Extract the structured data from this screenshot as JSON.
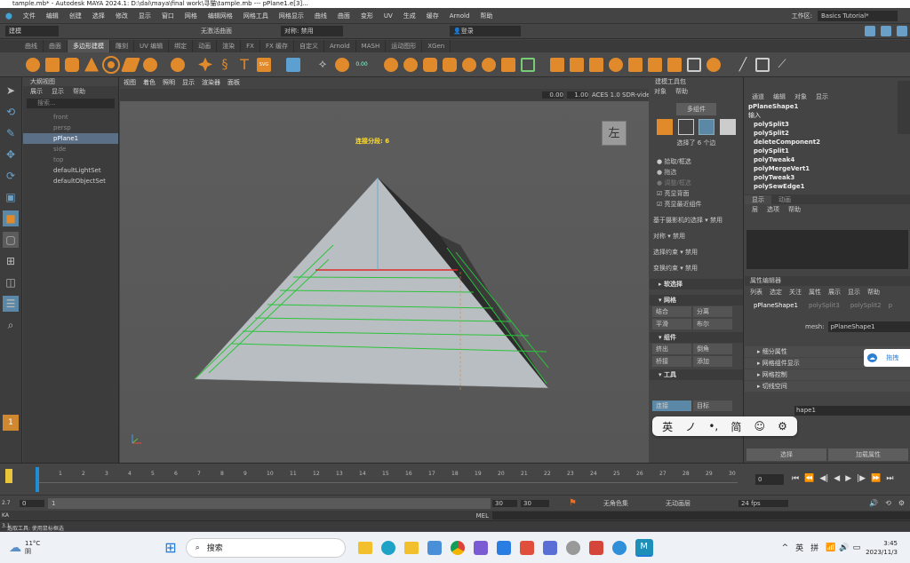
{
  "window": {
    "title": "tample.mb* - Autodesk MAYA 2024.1: D:\\dai\\maya\\final work\\寻猫\\tample.mb  ---  pPlane1.e[3]..."
  },
  "menu": [
    "文件",
    "编辑",
    "创建",
    "选择",
    "修改",
    "显示",
    "窗口",
    "网格",
    "编辑网格",
    "网格工具",
    "网格显示",
    "曲线",
    "曲面",
    "变形",
    "UV",
    "生成",
    "缓存",
    "Arnold",
    "帮助"
  ],
  "workspace": {
    "label": "工作区:",
    "value": "Basics Tutorial*"
  },
  "status_line": {
    "mode": "建模",
    "live_surface": "无激活曲面",
    "symmetry": "对称: 禁用",
    "login": "登录"
  },
  "shelf_tabs": [
    "曲线",
    "曲面",
    "多边形建模",
    "雕刻",
    "UV 编辑",
    "绑定",
    "动画",
    "渲染",
    "FX",
    "FX 缓存",
    "自定义",
    "Arnold",
    "MASH",
    "运动图形",
    "XGen"
  ],
  "shelf_active": "多边形建模",
  "outliner": {
    "title": "大纲视图",
    "menu": [
      "展示",
      "显示",
      "帮助"
    ],
    "search_placeholder": "搜索...",
    "items": [
      "front",
      "persp",
      "pPlane1",
      "side",
      "top",
      "defaultLightSet",
      "defaultObjectSet"
    ],
    "selected": "pPlane1"
  },
  "viewport": {
    "menu": [
      "视图",
      "着色",
      "照明",
      "显示",
      "渲染器",
      "面板"
    ],
    "value1": "0.00",
    "value2": "1.00",
    "colorspace": "ACES 1.0 SDR-vide",
    "hud": "连接分段: 6",
    "viewcube": "左"
  },
  "tool_settings": {
    "title": "建模工具包",
    "menu": [
      "对象",
      "帮助"
    ],
    "mode": "多组件",
    "selected_info": "选择了 6 个边",
    "options": [
      "拾取/框选",
      "拖选",
      "调整/框选"
    ],
    "checkboxes": [
      "亮显背面",
      "亮显最近组件"
    ],
    "camera_sel": {
      "label": "基于摄影机的选择",
      "value": "禁用"
    },
    "symmetry": {
      "label": "对称",
      "value": "禁用"
    },
    "sel_constraint": {
      "label": "选择约束",
      "value": "禁用"
    },
    "xform_constraint": {
      "label": "变换约束",
      "value": "禁用"
    },
    "soft_select": "软选择",
    "mesh_section": "网格",
    "mesh_buttons": [
      "结合",
      "分离",
      "平滑",
      "布尔"
    ],
    "component_section": "组件",
    "component_buttons": [
      "挤出",
      "倒角",
      "桥接",
      "添加"
    ],
    "tools_section": "工具",
    "tool_buttons": [
      "连接",
      "目标"
    ]
  },
  "channel_box": {
    "menu": [
      "通道",
      "编辑",
      "对象",
      "显示"
    ],
    "object": "pPlaneShape1",
    "inputs_label": "输入",
    "inputs": [
      "polySplit3",
      "polySplit2",
      "deleteComponent2",
      "polySplit1",
      "polyTweak4",
      "polyMergeVert1",
      "polyTweak3",
      "polySewEdge1"
    ],
    "layer_tabs": [
      "显示",
      "动画"
    ],
    "layer_menu": [
      "层",
      "选项",
      "帮助"
    ]
  },
  "attr_editor": {
    "title": "属性编辑器",
    "menu": [
      "列表",
      "选定",
      "关注",
      "属性",
      "展示",
      "显示",
      "帮助"
    ],
    "tabs": [
      "pPlaneShape1",
      "polySplit3",
      "polySplit2",
      "p"
    ],
    "mesh_label": "mesh:",
    "mesh_value": "pPlaneShape1",
    "sections": [
      "细分属性",
      "网格组件显示",
      "网格控制",
      "切线空间"
    ],
    "shape_text": "hape1",
    "select_btn": "选择",
    "load_btn": "加载属性",
    "side_btn": "拖拽"
  },
  "timeline": {
    "ticks": [
      "0",
      "1",
      "2",
      "3",
      "4",
      "5",
      "6",
      "7",
      "8",
      "9",
      "10",
      "11",
      "12",
      "13",
      "14",
      "15",
      "16",
      "17",
      "18",
      "19",
      "20",
      "21",
      "22",
      "23",
      "24",
      "25",
      "26",
      "27",
      "28",
      "29",
      "30"
    ],
    "current": "0"
  },
  "range": {
    "start": "0",
    "inner": "1",
    "end": "30",
    "end2": "30",
    "char_set": "无角色集",
    "anim_layer": "无动画层",
    "fps": "24 fps",
    "side1": "2.7",
    "side2": "KA",
    "side3": "3.1"
  },
  "cmd": {
    "label": "MEL"
  },
  "help": {
    "text": "选取工具: 使用鼠标框选"
  },
  "ime": [
    "英",
    "ノ",
    "•,",
    "简",
    "☺",
    "⚙"
  ],
  "taskbar": {
    "temp": "11°C",
    "weather": "阴",
    "search": "搜索",
    "lang1": "英",
    "lang2": "拼",
    "time": "3:45",
    "date": "2023/11/3"
  }
}
